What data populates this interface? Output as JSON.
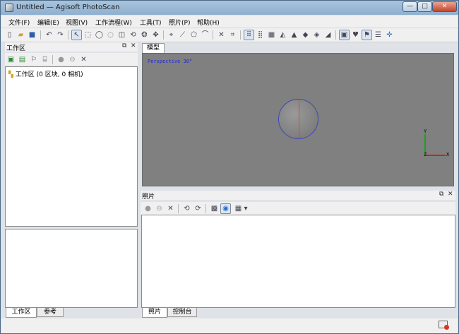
{
  "window": {
    "title": "Untitled — Agisoft PhotoScan",
    "controls": {
      "minimize": "—",
      "maximize": "□",
      "close": "✕"
    }
  },
  "menu": [
    "文件(F)",
    "编辑(E)",
    "视图(V)",
    "工作流程(W)",
    "工具(T)",
    "照片(P)",
    "帮助(H)"
  ],
  "toolbar": {
    "icons": [
      "new-file-icon",
      "open-folder-icon",
      "save-icon",
      "undo-icon",
      "redo-icon",
      "select-arrow-icon",
      "rect-select-icon",
      "circle-select-icon",
      "free-select-icon",
      "resize-region-icon",
      "rotate-region-icon",
      "rotate-object-icon",
      "move-point-icon",
      "ruler-icon",
      "polygon-icon",
      "measure-icon",
      "delete-icon",
      "crop-icon",
      "point-cloud-icon",
      "dense-cloud-icon",
      "solid-mesh-icon",
      "wireframe-icon",
      "shaded-icon",
      "textured-icon",
      "tiled-icon",
      "dem-icon",
      "cameras-icon",
      "shapes-icon",
      "markers-icon",
      "grid-icon",
      "navigate-icon"
    ]
  },
  "workspace": {
    "title": "工作区",
    "float_btn": "⧉",
    "close_btn": "✕",
    "tree_root": "工作区 (0 区块, 0 相机)",
    "tabs": [
      "工作区",
      "参考"
    ]
  },
  "model": {
    "tab": "模型",
    "perspective_label": "Perspective 30°",
    "axis_y": "Y",
    "axis_x": "X",
    "axis_z": "Z"
  },
  "photos": {
    "title": "照片",
    "float_btn": "⧉",
    "close_btn": "✕",
    "tabs": [
      "照片",
      "控制台"
    ],
    "dropdown_arrow": "▾"
  },
  "colors": {
    "viewport_bg": "#808080",
    "perspective_text": "#1e2bd0",
    "axis_x": "#d02020",
    "axis_y": "#1fa01f"
  }
}
